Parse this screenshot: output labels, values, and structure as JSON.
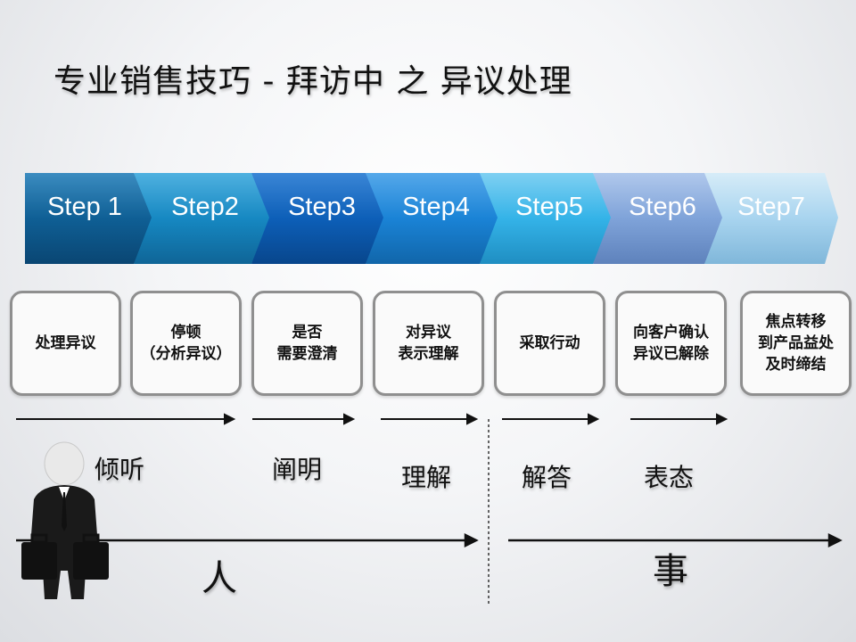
{
  "title": "专业销售技巧 - 拜访中 之 异议处理",
  "steps": [
    "Step 1",
    "Step2",
    "Step3",
    "Step4",
    "Step5",
    "Step6",
    "Step7"
  ],
  "boxes": [
    "处理异议",
    "停顿\n（分析异议）",
    "是否\n需要澄清",
    "对异议\n表示理解",
    "采取行动",
    "向客户确认\n异议已解除",
    "焦点转移\n到产品益处\n及时缔结"
  ],
  "words": [
    "倾听",
    "阐明",
    "理解",
    "解答",
    "表态"
  ],
  "groups": {
    "left": "人",
    "right": "事"
  },
  "colors": {
    "step_colors": [
      "#0f5f95",
      "#1688c2",
      "#0d5fb8",
      "#1a83d6",
      "#34b3e8",
      "#7fa3d9",
      "#a8d4ef"
    ]
  }
}
